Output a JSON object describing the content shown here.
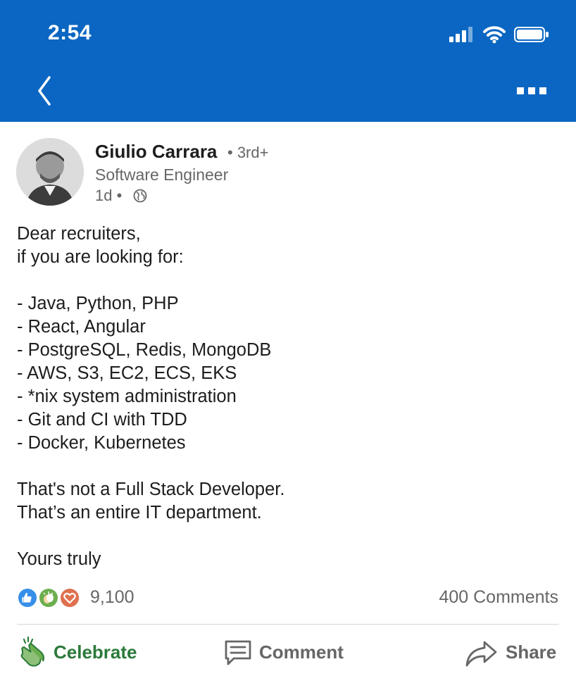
{
  "status_bar": {
    "time": "2:54"
  },
  "nav": {
    "back_icon": "chevron-left-icon",
    "more_icon": "more-horizontal-icon"
  },
  "post": {
    "author": {
      "name": "Giulio Carrara",
      "degree": "• 3rd+",
      "headline": "Software Engineer"
    },
    "time_ago": "1d •",
    "visibility_icon": "globe-icon",
    "body_lines": [
      "Dear recruiters,",
      "if you are looking for:",
      "",
      "- Java, Python, PHP",
      "- React, Angular",
      "- PostgreSQL, Redis, MongoDB",
      "- AWS, S3, EC2, ECS, EKS",
      "- *nix system administration",
      "- Git and CI with TDD",
      "- Docker, Kubernetes",
      "",
      "That's not a Full Stack Developer.",
      "That’s an entire IT department.",
      "",
      "Yours truly"
    ],
    "reaction_count": "9,100",
    "comments_count": "400 Comments"
  },
  "actions": {
    "celebrate": "Celebrate",
    "comment": "Comment",
    "share": "Share"
  },
  "colors": {
    "brand_blue": "#0a66c2",
    "celebrate_green": "#2b7a3a",
    "like_blue": "#378fe9",
    "love_red": "#df704d"
  }
}
